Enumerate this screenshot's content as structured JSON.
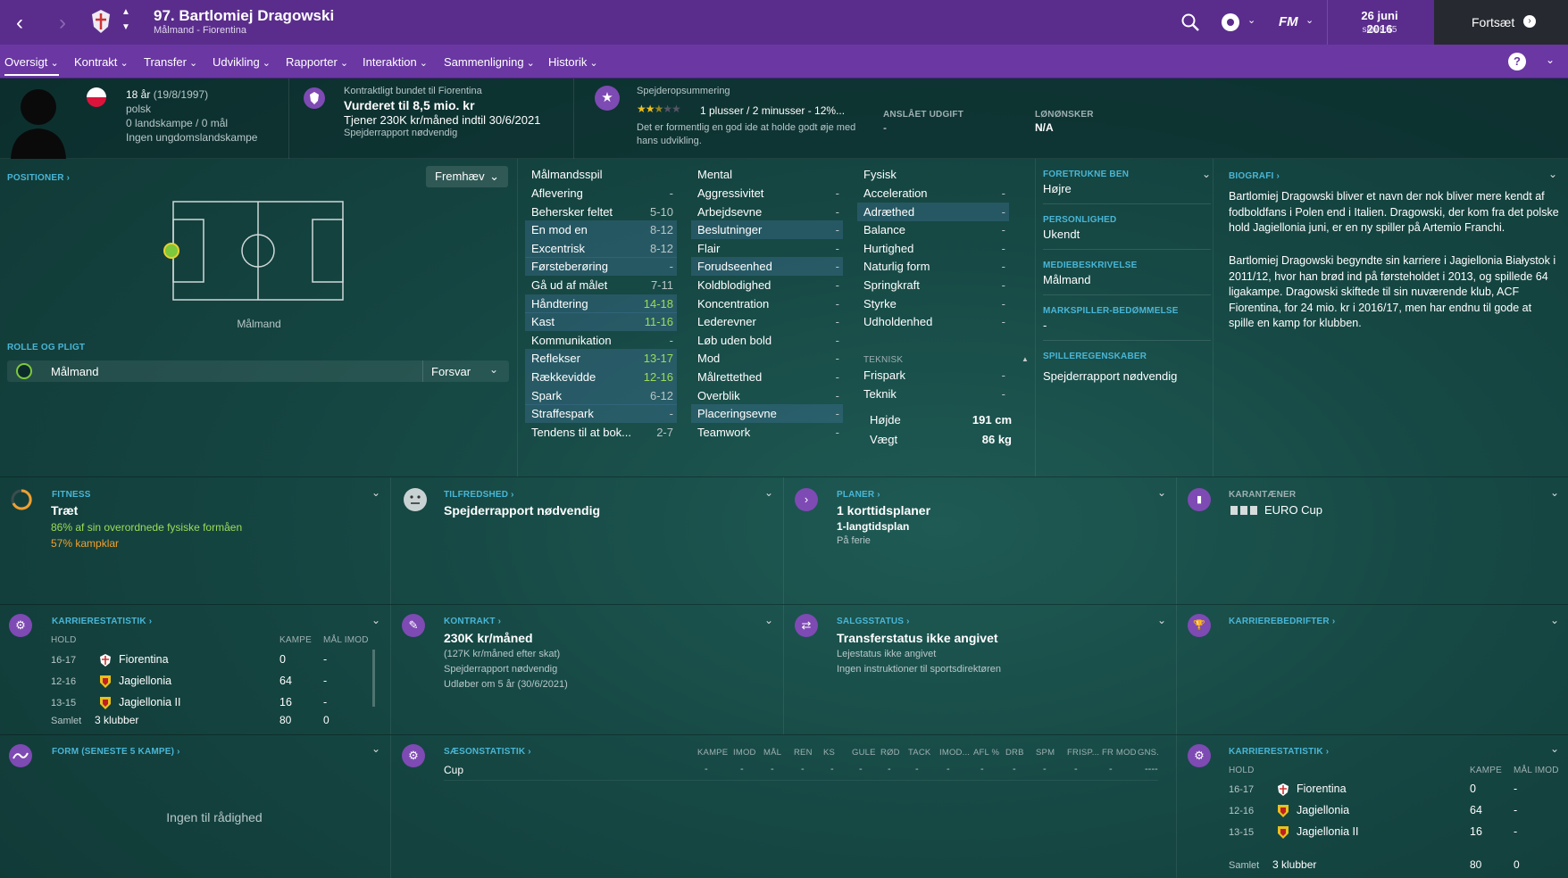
{
  "header": {
    "title": "97. Bartlomiej Dragowski",
    "subtitle": "Målmand - Fiorentina",
    "date": "26 juni 2016",
    "time": "søn 9:15",
    "continue_label": "Fortsæt",
    "fm_label": "FM"
  },
  "tabs": [
    {
      "label": "Oversigt"
    },
    {
      "label": "Kontrakt"
    },
    {
      "label": "Transfer"
    },
    {
      "label": "Udvikling"
    },
    {
      "label": "Rapporter"
    },
    {
      "label": "Interaktion"
    },
    {
      "label": "Sammenligning"
    },
    {
      "label": "Historik"
    }
  ],
  "profile": {
    "age": "18 år",
    "dob": "(19/8/1997)",
    "nationality": "polsk",
    "caps": "0 landskampe / 0 mål",
    "youth": "Ingen ungdomslandskampe"
  },
  "contract_summary": {
    "line1": "Kontraktligt bundet til Fiorentina",
    "line2": "Vurderet til 8,5 mio. kr",
    "line3": "Tjener 230K kr/måned indtil 30/6/2021",
    "line4": "Spejderrapport nødvendig"
  },
  "scout": {
    "heading": "Spejderopsummering",
    "stars": 2.5,
    "summary": "1 plusser / 2 minusser - 12%...",
    "text": "Det er formentlig en god ide at holde godt øje med hans udvikling."
  },
  "expense": {
    "label": "ANSLÅET UDGIFT",
    "value": "-"
  },
  "wage": {
    "label": "LØNØNSKER",
    "value": "N/A"
  },
  "positions": {
    "label": "POSITIONER",
    "highlight_label": "Fremhæv",
    "position_name": "Målmand"
  },
  "role": {
    "label": "ROLLE OG PLIGT",
    "role": "Målmand",
    "duty": "Forsvar"
  },
  "attributes": {
    "technical_header": "Målmandsspil",
    "mental_header": "Mental",
    "physical_header": "Fysisk",
    "technical_sub": "TEKNISK",
    "goalkeeping": [
      {
        "name": "Aflevering",
        "value": "-"
      },
      {
        "name": "Behersker feltet",
        "value": "5-10"
      },
      {
        "name": "En mod en",
        "value": "8-12"
      },
      {
        "name": "Excentrisk",
        "value": "8-12"
      },
      {
        "name": "Førsteberøring",
        "value": "-"
      },
      {
        "name": "Gå ud af målet",
        "value": "7-11"
      },
      {
        "name": "Håndtering",
        "value": "14-18"
      },
      {
        "name": "Kast",
        "value": "11-16"
      },
      {
        "name": "Kommunikation",
        "value": "-"
      },
      {
        "name": "Reflekser",
        "value": "13-17"
      },
      {
        "name": "Rækkevidde",
        "value": "12-16"
      },
      {
        "name": "Spark",
        "value": "6-12"
      },
      {
        "name": "Straffespark",
        "value": "-"
      },
      {
        "name": "Tendens til at bok...",
        "value": "2-7"
      }
    ],
    "mental": [
      {
        "name": "Aggressivitet",
        "value": "-"
      },
      {
        "name": "Arbejdsevne",
        "value": "-"
      },
      {
        "name": "Beslutninger",
        "value": "-"
      },
      {
        "name": "Flair",
        "value": "-"
      },
      {
        "name": "Forudseenhed",
        "value": "-"
      },
      {
        "name": "Koldblodighed",
        "value": "-"
      },
      {
        "name": "Koncentration",
        "value": "-"
      },
      {
        "name": "Lederevner",
        "value": "-"
      },
      {
        "name": "Løb uden bold",
        "value": "-"
      },
      {
        "name": "Mod",
        "value": "-"
      },
      {
        "name": "Målrettethed",
        "value": "-"
      },
      {
        "name": "Overblik",
        "value": "-"
      },
      {
        "name": "Placeringsevne",
        "value": "-"
      },
      {
        "name": "Teamwork",
        "value": "-"
      }
    ],
    "physical": [
      {
        "name": "Acceleration",
        "value": "-"
      },
      {
        "name": "Adræthed",
        "value": "-"
      },
      {
        "name": "Balance",
        "value": "-"
      },
      {
        "name": "Hurtighed",
        "value": "-"
      },
      {
        "name": "Naturlig form",
        "value": "-"
      },
      {
        "name": "Springkraft",
        "value": "-"
      },
      {
        "name": "Styrke",
        "value": "-"
      },
      {
        "name": "Udholdenhed",
        "value": "-"
      }
    ],
    "technical": [
      {
        "name": "Frispark",
        "value": "-"
      },
      {
        "name": "Teknik",
        "value": "-"
      }
    ],
    "height_label": "Højde",
    "height": "191 cm",
    "weight_label": "Vægt",
    "weight": "86 kg"
  },
  "info": {
    "foot_label": "FORETRUKNE BEN",
    "foot": "Højre",
    "personality_label": "PERSONLIGHED",
    "personality": "Ukendt",
    "media_label": "MEDIEBESKRIVELSE",
    "media": "Målmand",
    "rating_label": "MARKSPILLER-BEDØMMELSE",
    "rating": "-",
    "traits_label": "SPILLEREGENSKABER",
    "traits": "Spejderrapport nødvendig"
  },
  "bio": {
    "label": "BIOGRAFI",
    "p1": "Bartlomiej Dragowski bliver et navn der nok bliver mere kendt af fodboldfans i Polen end i Italien. Dragowski, der kom fra det polske hold Jagiellonia juni, er en ny spiller på Artemio Franchi.",
    "p2": "Bartlomiej Dragowski begyndte sin karriere i Jagiellonia Białystok i 2011/12, hvor han brød ind på førsteholdet i 2013, og spillede 64 ligakampe. Dragowski skiftede til sin nuværende klub, ACF Fiorentina, for 24 mio. kr i 2016/17, men har endnu til gode at spille en kamp for klubben."
  },
  "fitness": {
    "label": "FITNESS",
    "status": "Træt",
    "line1": "86% af sin overordnede fysiske formåen",
    "line2": "57% kampklar"
  },
  "happiness": {
    "label": "TILFREDSHED",
    "text": "Spejderrapport nødvendig"
  },
  "plans": {
    "label": "PLANER",
    "main": "1 korttidsplaner",
    "sub": "1-langtidsplan",
    "note": "På ferie"
  },
  "quarantine": {
    "label": "KARANTÆNER",
    "text": "EURO Cup"
  },
  "career": {
    "label": "KARRIERESTATISTIK",
    "col_club": "HOLD",
    "col_apps": "KAMPE",
    "col_goals": "MÅL IMOD",
    "rows": [
      {
        "season": "16-17",
        "club": "Fiorentina",
        "apps": "0",
        "goals": "-"
      },
      {
        "season": "12-16",
        "club": "Jagiellonia",
        "apps": "64",
        "goals": "-"
      },
      {
        "season": "13-15",
        "club": "Jagiellonia II",
        "apps": "16",
        "goals": "-"
      }
    ],
    "total_label": "Samlet",
    "total_clubs": "3 klubber",
    "total_apps": "80",
    "total_goals": "0"
  },
  "contract": {
    "label": "KONTRAKT",
    "wage": "230K kr/måned",
    "after_tax": "(127K kr/måned efter skat)",
    "scout": "Spejderrapport nødvendig",
    "expires": "Udløber om 5 år (30/6/2021)"
  },
  "sale": {
    "label": "SALGSSTATUS",
    "status": "Transferstatus ikke angivet",
    "loan": "Lejestatus ikke angivet",
    "instr": "Ingen instruktioner til sportsdirektøren"
  },
  "achievements": {
    "label": "KARRIEREBEDRIFTER"
  },
  "form": {
    "label": "FORM (SENESTE 5 KAMPE)",
    "empty": "Ingen til rådighed"
  },
  "season": {
    "label": "SÆSONSTATISTIK",
    "cols": [
      "KAMPE",
      "IMOD",
      "MÅL",
      "REN",
      "KS",
      "GULE",
      "RØD",
      "TACK",
      "IMOD...",
      "AFL %",
      "DRB",
      "SPM",
      "FRISP...",
      "FR MOD",
      "GNS."
    ],
    "row_label": "Cup",
    "row_values": [
      "-",
      "-",
      "-",
      "-",
      "-",
      "-",
      "-",
      "-",
      "-",
      "-",
      "-",
      "-",
      "-",
      "-",
      "----"
    ]
  },
  "colors": {
    "topbar": "#5a2d8c",
    "subnav": "#6a37a3",
    "accent": "#49b6d6",
    "green": "#9bdc5a",
    "orange": "#f0a030"
  }
}
